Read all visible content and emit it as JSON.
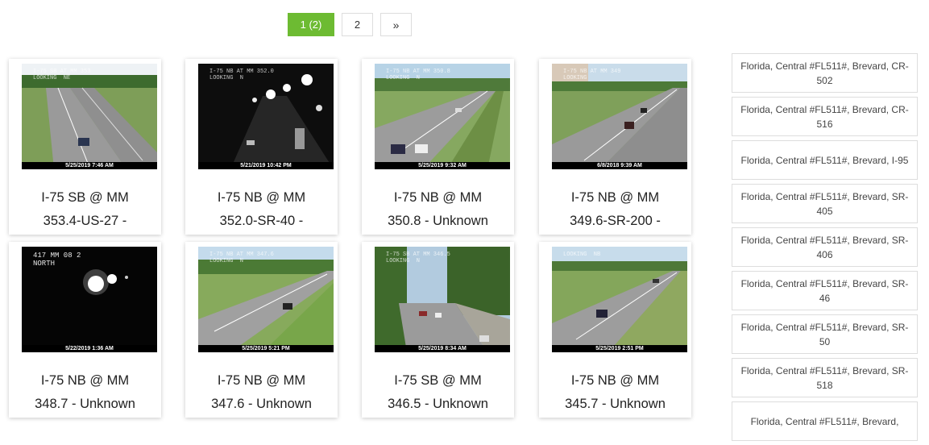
{
  "pagination": {
    "active_label": "1 (2)",
    "page2_label": "2",
    "next_label": "»"
  },
  "cameras": [
    {
      "line1": "I-75 SB @ MM",
      "line2": "353.4-US-27 -",
      "timestamp": "5/25/2019 7:46 AM",
      "overlay": "I-75 SB AT MM 353\nLOOKING  NE"
    },
    {
      "line1": "I-75 NB @ MM",
      "line2": "352.0-SR-40 -",
      "timestamp": "5/21/2019 10:42 PM",
      "overlay": "I-75 NB AT MM 352.0\nLOOKING  N"
    },
    {
      "line1": "I-75 NB @ MM",
      "line2": "350.8 - Unknown",
      "timestamp": "5/25/2019 9:32 AM",
      "overlay": "I-75 NB AT MM 350.8\nLOOKING  N"
    },
    {
      "line1": "I-75 NB @ MM",
      "line2": "349.6-SR-200 -",
      "timestamp": "6/8/2018 9:39 AM",
      "overlay": "I-75 NB AT MM 349\nLOOKING"
    },
    {
      "line1": "I-75 NB @ MM",
      "line2": "348.7 - Unknown",
      "timestamp": "5/22/2019 1:36 AM",
      "overlay": "417 MM 08 2\nNORTH"
    },
    {
      "line1": "I-75 NB @ MM",
      "line2": "347.6 - Unknown",
      "timestamp": "5/25/2019 5:21 PM",
      "overlay": "I-75 NB AT MM 347.6\nLOOKING  N"
    },
    {
      "line1": "I-75 SB @ MM",
      "line2": "346.5 - Unknown",
      "timestamp": "5/25/2019 8:34 AM",
      "overlay": "I-75 SB AT MM 346.5\nLOOKING  N"
    },
    {
      "line1": "I-75 NB @ MM",
      "line2": "345.7 - Unknown",
      "timestamp": "5/25/2019 2:51 PM",
      "overlay": "LOOKING  NB"
    }
  ],
  "sidebar": {
    "items": [
      "Florida, Central #FL511#, Brevard, CR-502",
      "Florida, Central #FL511#, Brevard, CR-516",
      "Florida, Central #FL511#, Brevard, I-95",
      "Florida, Central #FL511#, Brevard, SR-405",
      "Florida, Central #FL511#, Brevard, SR-406",
      "Florida, Central #FL511#, Brevard, SR-46",
      "Florida, Central #FL511#, Brevard, SR-50",
      "Florida, Central #FL511#, Brevard, SR-518",
      "Florida, Central #FL511#, Brevard,"
    ]
  }
}
